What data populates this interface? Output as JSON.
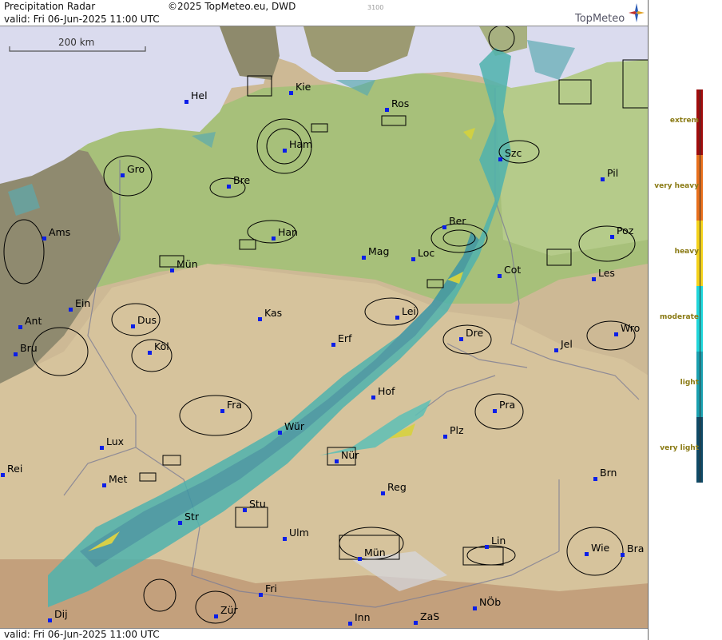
{
  "header": {
    "title": "Precipitation Radar",
    "copyright": "©2025 TopMeteo.eu, DWD",
    "code": "3100",
    "valid": "valid:  Fri  06-Jun-2025 11:00 UTC",
    "logo": "TopMeteo"
  },
  "footer": {
    "valid": "valid:  Fri  06-Jun-2025 11:00 UTC"
  },
  "scale": {
    "label": "200 km"
  },
  "cities": [
    "Hel",
    "Kie",
    "Ros",
    "Ham",
    "Szc",
    "Gro",
    "Bre",
    "Pil",
    "Ber",
    "Ams",
    "Han",
    "Poz",
    "Mag",
    "Loc",
    "Mün",
    "Cot",
    "Les",
    "Ein",
    "Kas",
    "Lei",
    "Ant",
    "Dus",
    "Wro",
    "Dre",
    "Bru",
    "Köl",
    "Erf",
    "Jel",
    "Hof",
    "Fra",
    "Pra",
    "Würz",
    "Plz",
    "Lux",
    "Nür",
    "Rei",
    "Met",
    "Brn",
    "Reg",
    "Stu",
    "Str",
    "Ulm",
    "Lin",
    "Mün2",
    "Wie",
    "Bra",
    "Fri",
    "Dij",
    "Zür",
    "NÖb",
    "Inn",
    "ZaS"
  ],
  "city_labels": {
    "Hel": "Hel",
    "Kie": "Kie",
    "Ros": "Ros",
    "Ham": "Ham",
    "Szc": "Szc",
    "Gro": "Gro",
    "Bre": "Bre",
    "Pil": "Pil",
    "Ber": "Ber",
    "Ams": "Ams",
    "Han": "Han",
    "Poz": "Poz",
    "Mag": "Mag",
    "Loc": "Loc",
    "Mün": "Mün",
    "Cot": "Cot",
    "Les": "Les",
    "Ein": "Ein",
    "Kas": "Kas",
    "Lei": "Lei",
    "Ant": "Ant",
    "Dus": "Dus",
    "Wro": "Wro",
    "Dre": "Dre",
    "Bru": "Bru",
    "Köl": "Köl",
    "Erf": "Erf",
    "Jel": "Jel",
    "Hof": "Hof",
    "Fra": "Fra",
    "Pra": "Pra",
    "Würz": "Wür",
    "Plz": "Plz",
    "Lux": "Lux",
    "Nür": "Nür",
    "Rei": "Rei",
    "Met": "Met",
    "Brn": "Brn",
    "Reg": "Reg",
    "Stu": "Stu",
    "Str": "Str",
    "Ulm": "Ulm",
    "Lin": "Lin",
    "Mün2": "Mün",
    "Wie": "Wie",
    "Bra": "Bra",
    "Fri": "Fri",
    "Dij": "Dij",
    "Zür": "Zür",
    "NÖb": "NÖb",
    "Inn": "Inn",
    "ZaS": "ZaS"
  },
  "legend": {
    "levels": [
      {
        "label": "extrem",
        "color": "#a00c0c"
      },
      {
        "label": "very heavy",
        "color": "#e8701c"
      },
      {
        "label": "heavy",
        "color": "#f4d21a"
      },
      {
        "label": "moderate",
        "color": "#1fd6da"
      },
      {
        "label": "light",
        "color": "#1aa0b0"
      },
      {
        "label": "very light",
        "color": "#104a66"
      }
    ]
  },
  "colors": {
    "sea": "#dbdcef",
    "lowland": "#a8c27a",
    "upland": "#d9c9a4",
    "mountain": "#c6a887",
    "nl_belgium": "#8f8a70",
    "radar_light": "#4fb6b0",
    "radar_heavy": "#d7d13a"
  }
}
